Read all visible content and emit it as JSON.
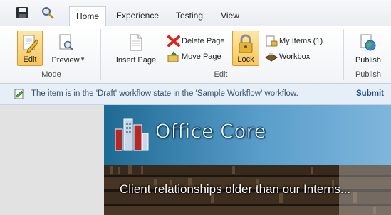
{
  "quick_access": {
    "save_icon": "floppy-disk-icon",
    "search_icon": "magnifier-icon"
  },
  "tabs": [
    {
      "label": "Home",
      "active": true
    },
    {
      "label": "Experience",
      "active": false
    },
    {
      "label": "Testing",
      "active": false
    },
    {
      "label": "View",
      "active": false
    }
  ],
  "ribbon": {
    "mode_group": {
      "label": "Mode",
      "edit_label": "Edit",
      "preview_label": "Preview"
    },
    "edit_group": {
      "label": "Edit",
      "insert_page_label": "Insert Page",
      "delete_page_label": "Delete Page",
      "move_page_label": "Move Page",
      "lock_label": "Lock",
      "my_items_label": "My Items (1)",
      "workbox_label": "Workbox"
    },
    "publish_group": {
      "label": "Publish",
      "publish_label": "Publish"
    }
  },
  "notification": {
    "text": "The item is in the 'Draft' workflow state in the 'Sample Workflow' workflow.",
    "action": "Submit"
  },
  "site": {
    "title": "Office Core",
    "tagline": "Client relationships older than our Interns..."
  },
  "colors": {
    "accent_pressed": "#f8c65e",
    "notification_bg": "#e6eef7",
    "header_blue": "#1d6a93",
    "link": "#1b4a8a"
  }
}
